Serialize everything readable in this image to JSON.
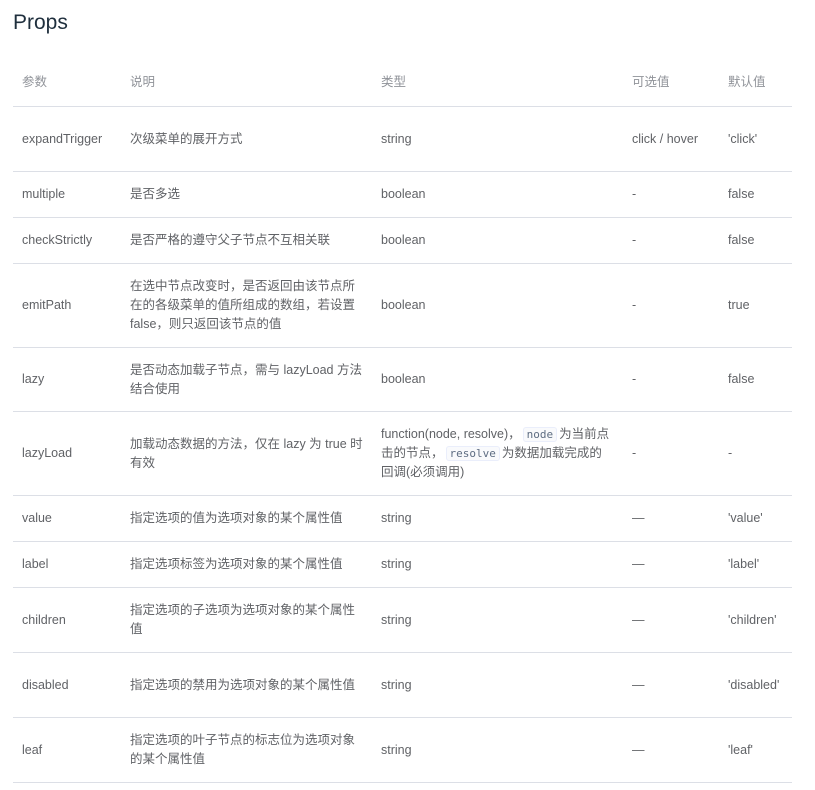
{
  "section": {
    "title": "Props"
  },
  "table": {
    "headers": [
      "参数",
      "说明",
      "类型",
      "可选值",
      "默认值"
    ],
    "rows": [
      {
        "param": "expandTrigger",
        "desc": "次级菜单的展开方式",
        "type": "string",
        "options": "click / hover",
        "default": "'click'"
      },
      {
        "param": "multiple",
        "desc": "是否多选",
        "type": "boolean",
        "options": "-",
        "default": "false"
      },
      {
        "param": "checkStrictly",
        "desc": "是否严格的遵守父子节点不互相关联",
        "type": "boolean",
        "options": "-",
        "default": "false"
      },
      {
        "param": "emitPath",
        "desc": "在选中节点改变时，是否返回由该节点所在的各级菜单的值所组成的数组，若设置 false，则只返回该节点的值",
        "type": "boolean",
        "options": "-",
        "default": "true"
      },
      {
        "param": "lazy",
        "desc": "是否动态加载子节点，需与 lazyLoad 方法结合使用",
        "type": "boolean",
        "options": "-",
        "default": "false"
      },
      {
        "param": "lazyLoad",
        "desc": "加载动态数据的方法，仅在 lazy 为 true 时有效",
        "type_parts": {
          "prefix": "function(node, resolve)，",
          "code1": "node",
          "mid": "为当前点击的节点，",
          "code2": "resolve",
          "suffix": "为数据加载完成的回调(必须调用)"
        },
        "options": "-",
        "default": "-"
      },
      {
        "param": "value",
        "desc": "指定选项的值为选项对象的某个属性值",
        "type": "string",
        "options": "—",
        "default": "'value'"
      },
      {
        "param": "label",
        "desc": "指定选项标签为选项对象的某个属性值",
        "type": "string",
        "options": "—",
        "default": "'label'"
      },
      {
        "param": "children",
        "desc": "指定选项的子选项为选项对象的某个属性值",
        "type": "string",
        "options": "—",
        "default": "'children'"
      },
      {
        "param": "disabled",
        "desc": "指定选项的禁用为选项对象的某个属性值",
        "type": "string",
        "options": "—",
        "default": "'disabled'"
      },
      {
        "param": "leaf",
        "desc": "指定选项的叶子节点的标志位为选项对象的某个属性值",
        "type": "string",
        "options": "—",
        "default": "'leaf'"
      }
    ]
  }
}
